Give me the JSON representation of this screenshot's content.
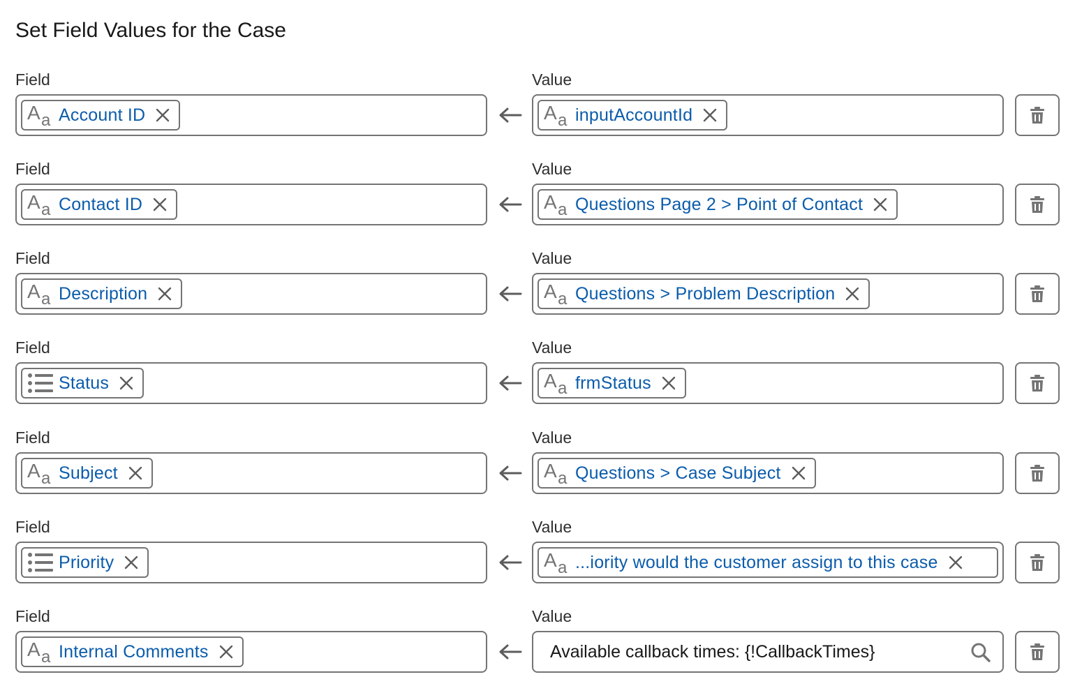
{
  "title": "Set Field Values for the Case",
  "labels": {
    "field": "Field",
    "value": "Value"
  },
  "rows": [
    {
      "field": {
        "icon": "text-icon",
        "text": "Account ID"
      },
      "value": {
        "type": "pill",
        "icon": "text-icon",
        "text": "inputAccountId"
      }
    },
    {
      "field": {
        "icon": "text-icon",
        "text": "Contact ID"
      },
      "value": {
        "type": "pill",
        "icon": "text-icon",
        "text": "Questions Page 2 > Point of Contact"
      }
    },
    {
      "field": {
        "icon": "text-icon",
        "text": "Description"
      },
      "value": {
        "type": "pill",
        "icon": "text-icon",
        "text": "Questions > Problem Description"
      }
    },
    {
      "field": {
        "icon": "picklist-icon",
        "text": "Status"
      },
      "value": {
        "type": "pill",
        "icon": "text-icon",
        "text": "frmStatus"
      }
    },
    {
      "field": {
        "icon": "text-icon",
        "text": "Subject"
      },
      "value": {
        "type": "pill",
        "icon": "text-icon",
        "text": "Questions > Case Subject"
      }
    },
    {
      "field": {
        "icon": "picklist-icon",
        "text": "Priority"
      },
      "value": {
        "type": "pill",
        "icon": "text-icon",
        "text": "...iority would the customer assign to this case"
      }
    },
    {
      "field": {
        "icon": "text-icon",
        "text": "Internal Comments"
      },
      "value": {
        "type": "input",
        "text": "Available callback times: {!CallbackTimes}"
      }
    }
  ],
  "colors": {
    "pill_text": "#0b5cab",
    "border": "#747474",
    "icon": "#747474",
    "label": "#2e2e2e"
  }
}
